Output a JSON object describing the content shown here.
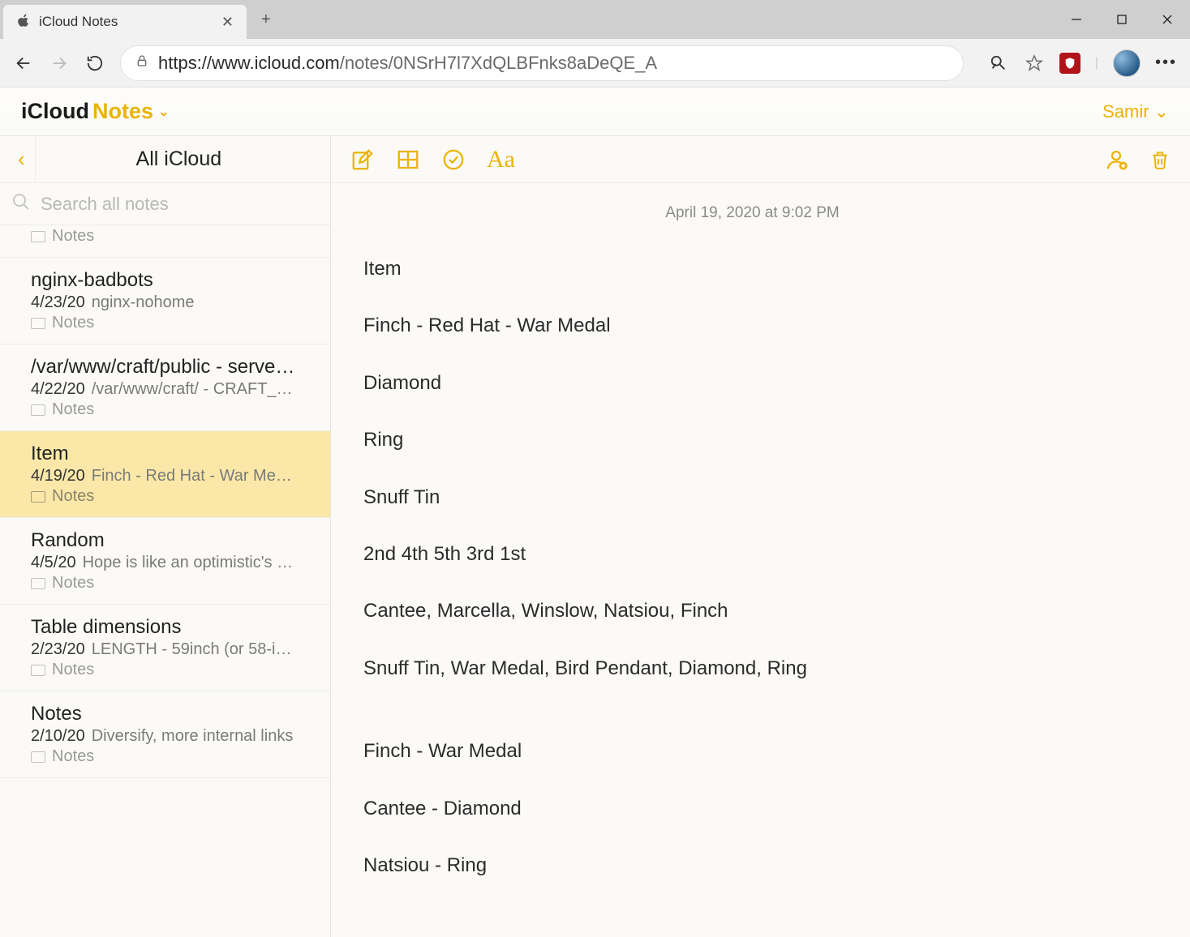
{
  "browser": {
    "tab_title": "iCloud Notes",
    "url_host": "https://www.icloud.com",
    "url_path": "/notes/0NSrH7l7XdQLBFnks8aDeQE_A"
  },
  "app_header": {
    "brand_black": "iCloud",
    "brand_gold": "Notes",
    "user": "Samir"
  },
  "sidebar": {
    "title": "All iCloud",
    "search_placeholder": "Search all notes",
    "items": [
      {
        "title": "",
        "date": "",
        "preview": "",
        "folder": "Notes",
        "partial_top": true
      },
      {
        "title": "nginx-badbots",
        "date": "4/23/20",
        "preview": "nginx-nohome",
        "folder": "Notes"
      },
      {
        "title": "/var/www/craft/public - serve…",
        "date": "4/22/20",
        "preview": "/var/www/craft/ - CRAFT_…",
        "folder": "Notes"
      },
      {
        "title": "Item",
        "date": "4/19/20",
        "preview": "Finch - Red Hat - War Med…",
        "folder": "Notes",
        "selected": true
      },
      {
        "title": "Random",
        "date": "4/5/20",
        "preview": "Hope is like an optimistic's …",
        "folder": "Notes"
      },
      {
        "title": "Table dimensions",
        "date": "2/23/20",
        "preview": "LENGTH - 59inch (or 58-i…",
        "folder": "Notes"
      },
      {
        "title": "Notes",
        "date": "2/10/20",
        "preview": "Diversify, more internal links",
        "folder": "Notes"
      }
    ]
  },
  "note": {
    "timestamp": "April 19, 2020 at 9:02 PM",
    "lines": [
      "Item",
      "Finch - Red Hat - War Medal",
      "Diamond",
      "Ring",
      "Snuff Tin",
      "2nd 4th 5th 3rd 1st",
      "Cantee, Marcella, Winslow, Natsiou, Finch",
      "Snuff Tin, War Medal, Bird Pendant, Diamond, Ring",
      "Finch - War Medal",
      "Cantee - Diamond",
      "Natsiou - Ring"
    ]
  }
}
